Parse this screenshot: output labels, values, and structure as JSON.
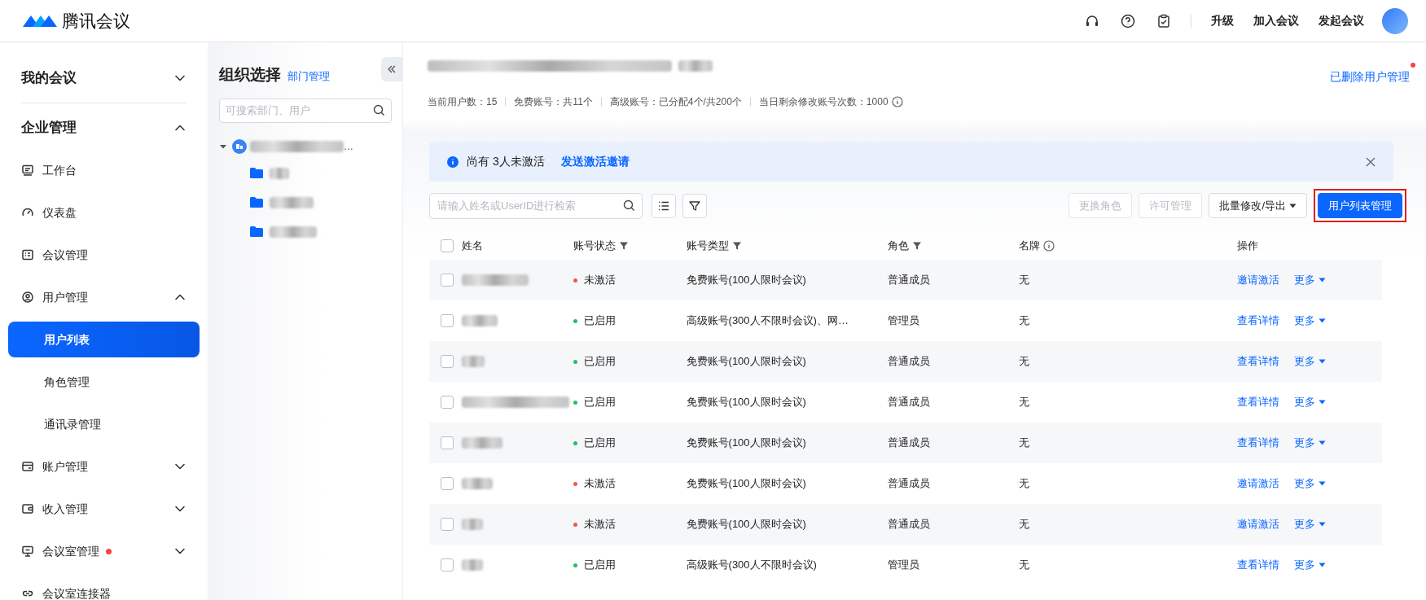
{
  "topbar": {
    "logo_text": "腾讯会议",
    "links": [
      "升级",
      "加入会议",
      "发起会议"
    ]
  },
  "sidebar": {
    "items": [
      {
        "label": "我的会议",
        "expanded": false,
        "selected": false
      },
      {
        "label": "企业管理",
        "expanded": true,
        "selected": false,
        "children": [
          {
            "label": "工作台",
            "selected": false,
            "notice": false
          },
          {
            "label": "仪表盘",
            "selected": false,
            "notice": false
          },
          {
            "label": "会议管理",
            "selected": false,
            "notice": false
          },
          {
            "label": "用户管理",
            "expanded": true,
            "selected": false,
            "notice": false,
            "children": [
              {
                "label": "用户列表",
                "selected": true
              },
              {
                "label": "角色管理",
                "selected": false
              },
              {
                "label": "通讯录管理",
                "selected": false
              }
            ]
          },
          {
            "label": "账户管理",
            "expanded": false,
            "selected": false,
            "notice": false
          },
          {
            "label": "收入管理",
            "expanded": false,
            "selected": false,
            "notice": false
          },
          {
            "label": "会议室管理",
            "expanded": false,
            "selected": false,
            "notice": true
          },
          {
            "label": "会议室连接器",
            "selected": false,
            "notice": false
          }
        ]
      }
    ]
  },
  "org_panel": {
    "title": "组织选择",
    "link": "部门管理",
    "search": {
      "placeholder": "可搜索部门、用户"
    },
    "root_suffix": "…",
    "tree": {
      "expanded": true,
      "children": [
        {
          "selected": false
        },
        {
          "selected": false
        },
        {
          "selected": false
        }
      ]
    }
  },
  "main": {
    "stats": [
      "当前用户数：15",
      "免费账号：共11个",
      "高级账号：已分配4个/共200个",
      "当日剩余修改账号次数：1000"
    ],
    "deleted_link": {
      "label": "已删除用户管理",
      "notice": true
    },
    "banner": {
      "text": "尚有 3人未激活",
      "link": "发送激活邀请"
    },
    "search": {
      "placeholder": "请输入姓名或UserID进行检索"
    },
    "buttons": [
      {
        "label": "更换角色",
        "kind": "plain",
        "disabled": true
      },
      {
        "label": "许可管理",
        "kind": "plain",
        "disabled": true
      },
      {
        "label": "批量修改/导出",
        "kind": "dropdown",
        "disabled": false
      },
      {
        "label": "用户列表管理",
        "kind": "primary",
        "disabled": false,
        "highlighted": true
      }
    ],
    "table": {
      "all_checked": false,
      "columns": [
        {
          "label": "姓名"
        },
        {
          "label": "账号状态",
          "filter": true
        },
        {
          "label": "账号类型",
          "filter": true
        },
        {
          "label": "角色",
          "filter": true
        },
        {
          "label": "名牌",
          "info": true
        },
        {
          "label": "操作"
        }
      ],
      "rows": [
        {
          "checked": false,
          "status": "未激活",
          "color": "#f5564a",
          "type": "免费账号(100人限时会议)",
          "role": "普通成员",
          "badge": "无",
          "action": "邀请激活",
          "more": "更多"
        },
        {
          "checked": false,
          "status": "已启用",
          "color": "#1fc163",
          "type": "高级账号(300人不限时会议)、网…",
          "role": "管理员",
          "badge": "无",
          "action": "查看详情",
          "more": "更多"
        },
        {
          "checked": false,
          "status": "已启用",
          "color": "#1fc163",
          "type": "免费账号(100人限时会议)",
          "role": "普通成员",
          "badge": "无",
          "action": "查看详情",
          "more": "更多"
        },
        {
          "checked": false,
          "status": "已启用",
          "color": "#1fc163",
          "type": "免费账号(100人限时会议)",
          "role": "普通成员",
          "badge": "无",
          "action": "查看详情",
          "more": "更多"
        },
        {
          "checked": false,
          "status": "已启用",
          "color": "#1fc163",
          "type": "免费账号(100人限时会议)",
          "role": "普通成员",
          "badge": "无",
          "action": "查看详情",
          "more": "更多"
        },
        {
          "checked": false,
          "status": "未激活",
          "color": "#f5564a",
          "type": "免费账号(100人限时会议)",
          "role": "普通成员",
          "badge": "无",
          "action": "邀请激活",
          "more": "更多"
        },
        {
          "checked": false,
          "status": "未激活",
          "color": "#f5564a",
          "type": "免费账号(100人限时会议)",
          "role": "普通成员",
          "badge": "无",
          "action": "邀请激活",
          "more": "更多"
        },
        {
          "checked": false,
          "status": "已启用",
          "color": "#1fc163",
          "type": "高级账号(300人不限时会议)",
          "role": "管理员",
          "badge": "无",
          "action": "查看详情",
          "more": "更多"
        }
      ]
    }
  }
}
